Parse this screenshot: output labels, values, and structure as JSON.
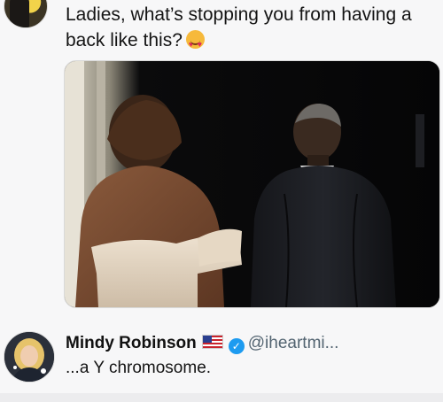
{
  "post": {
    "text": "Ladies, what’s stopping you from having a back like this?",
    "emoji_icon": "smiling-face-with-heart-eyes-icon"
  },
  "reply": {
    "name": "Mindy Robinson",
    "handle": "@iheartmi...",
    "text": "...a Y chromosome.",
    "flag_icon": "us-flag-icon",
    "verified_icon": "verified-badge-icon"
  },
  "colors": {
    "verified_blue": "#1d9bf0",
    "handle_gray": "#536471",
    "text": "#141414"
  }
}
